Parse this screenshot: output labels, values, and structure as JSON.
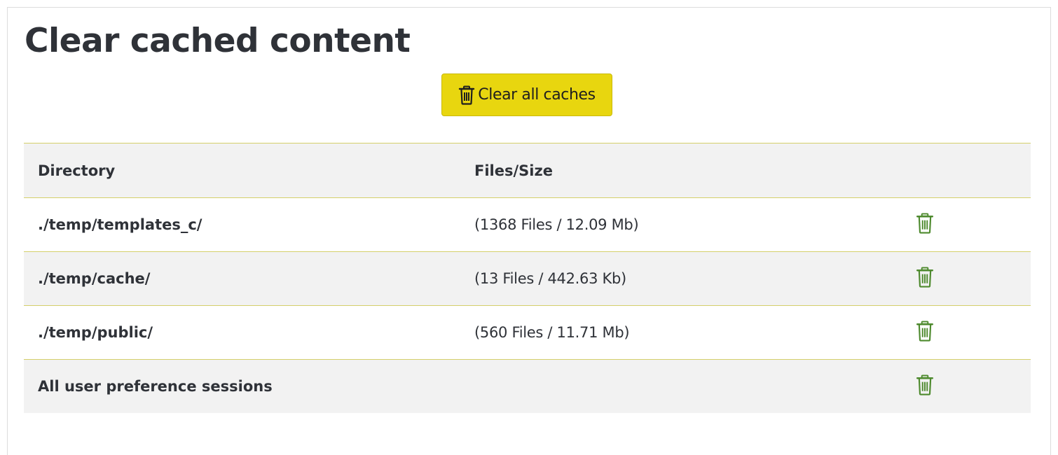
{
  "page": {
    "title": "Clear cached content"
  },
  "toolbar": {
    "clear_all_label": "Clear all caches",
    "clear_all_icon": "trash-icon",
    "accent_color": "#e8d60f"
  },
  "table": {
    "headers": {
      "directory": "Directory",
      "files_size": "Files/Size"
    },
    "rows": [
      {
        "directory": "./temp/templates_c/",
        "files_size": "(1368 Files / 12.09 Mb)",
        "action_icon": "trash-icon"
      },
      {
        "directory": "./temp/cache/",
        "files_size": "(13 Files / 442.63 Kb)",
        "action_icon": "trash-icon"
      },
      {
        "directory": "./temp/public/",
        "files_size": "(560 Files / 11.71 Mb)",
        "action_icon": "trash-icon"
      },
      {
        "directory": "All user preference sessions",
        "files_size": "",
        "action_icon": "trash-icon"
      }
    ],
    "action_icon_color": "#4e8a2e",
    "row_divider_color": "#d4cf6a"
  }
}
